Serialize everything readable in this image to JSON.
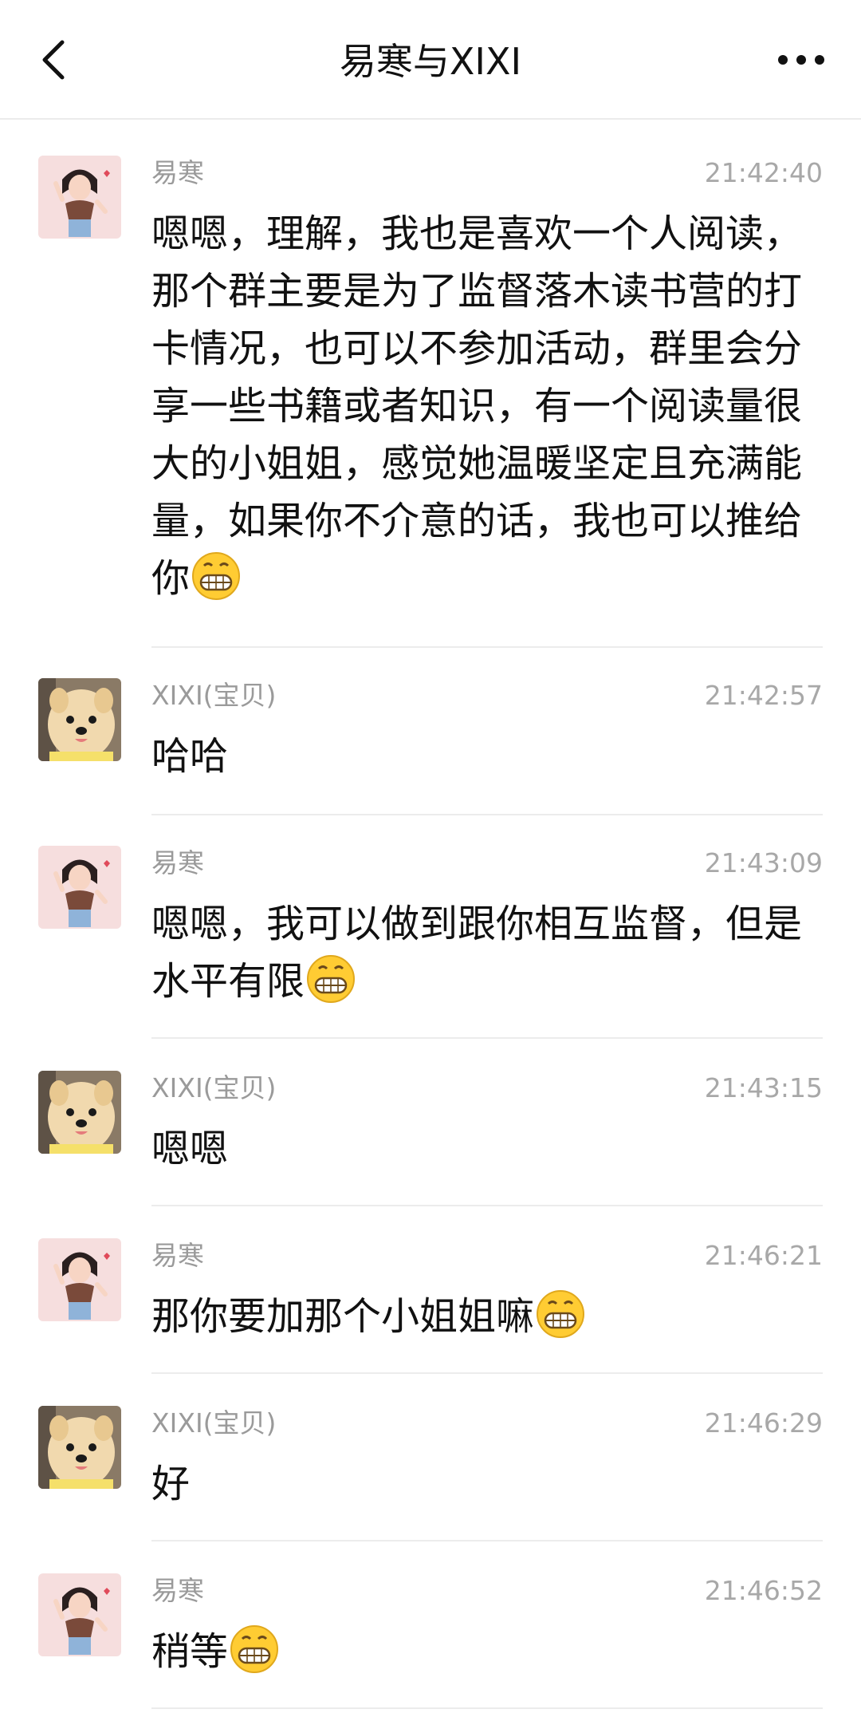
{
  "header": {
    "title": "易寒与XIXI"
  },
  "messages": [
    {
      "sender": "易寒",
      "avatar": "girl-avatar",
      "time": "21:42:40",
      "text": "嗯嗯，理解，我也是喜欢一个人阅读，那个群主要是为了监督落木读书营的打卡情况，也可以不参加活动，群里会分享一些书籍或者知识，有一个阅读量很大的小姐姐，感觉她温暖坚定且充满能量，如果你不介意的话，我也可以推给你",
      "emoji": "grinning-face-emoji"
    },
    {
      "sender": "XIXI(宝贝)",
      "avatar": "dog-avatar",
      "time": "21:42:57",
      "text": "哈哈",
      "emoji": ""
    },
    {
      "sender": "易寒",
      "avatar": "girl-avatar",
      "time": "21:43:09",
      "text": "嗯嗯，我可以做到跟你相互监督，但是水平有限",
      "emoji": "grinning-face-emoji"
    },
    {
      "sender": "XIXI(宝贝)",
      "avatar": "dog-avatar",
      "time": "21:43:15",
      "text": "嗯嗯",
      "emoji": ""
    },
    {
      "sender": "易寒",
      "avatar": "girl-avatar",
      "time": "21:46:21",
      "text": "那你要加那个小姐姐嘛",
      "emoji": "grinning-face-emoji"
    },
    {
      "sender": "XIXI(宝贝)",
      "avatar": "dog-avatar",
      "time": "21:46:29",
      "text": "好",
      "emoji": ""
    },
    {
      "sender": "易寒",
      "avatar": "girl-avatar",
      "time": "21:46:52",
      "text": "稍等",
      "emoji": "grinning-face-emoji"
    }
  ]
}
